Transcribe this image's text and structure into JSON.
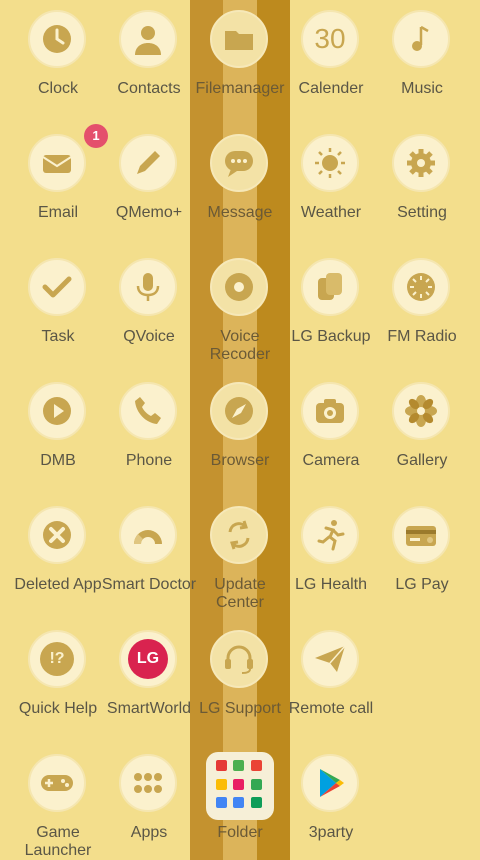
{
  "apps": [
    {
      "id": "clock",
      "label": "Clock",
      "icon": "clock-icon"
    },
    {
      "id": "contacts",
      "label": "Contacts",
      "icon": "person-icon"
    },
    {
      "id": "filemanager",
      "label": "Filemanager",
      "icon": "folder-icon"
    },
    {
      "id": "calender",
      "label": "Calender",
      "icon": "calendar-30-icon",
      "icon_text": "30"
    },
    {
      "id": "music",
      "label": "Music",
      "icon": "music-note-icon"
    },
    {
      "id": "email",
      "label": "Email",
      "icon": "envelope-icon",
      "badge": "1"
    },
    {
      "id": "qmemo",
      "label": "QMemo+",
      "icon": "pencil-icon"
    },
    {
      "id": "message",
      "label": "Message",
      "icon": "chat-bubble-icon"
    },
    {
      "id": "weather",
      "label": "Weather",
      "icon": "sun-icon"
    },
    {
      "id": "setting",
      "label": "Setting",
      "icon": "gear-icon"
    },
    {
      "id": "task",
      "label": "Task",
      "icon": "checkmark-icon"
    },
    {
      "id": "qvoice",
      "label": "QVoice",
      "icon": "microphone-icon"
    },
    {
      "id": "voice-recoder",
      "label": "Voice Recoder",
      "icon": "record-icon"
    },
    {
      "id": "lg-backup",
      "label": "LG Backup",
      "icon": "backup-cards-icon"
    },
    {
      "id": "fm-radio",
      "label": "FM Radio",
      "icon": "radio-dial-icon"
    },
    {
      "id": "dmb",
      "label": "DMB",
      "icon": "play-icon"
    },
    {
      "id": "phone",
      "label": "Phone",
      "icon": "phone-handset-icon"
    },
    {
      "id": "browser",
      "label": "Browser",
      "icon": "compass-icon"
    },
    {
      "id": "camera",
      "label": "Camera",
      "icon": "camera-icon"
    },
    {
      "id": "gallery",
      "label": "Gallery",
      "icon": "flower-icon"
    },
    {
      "id": "deleted-app",
      "label": "Deleted App",
      "icon": "x-circle-icon"
    },
    {
      "id": "smart-doctor",
      "label": "Smart Doctor",
      "icon": "gauge-icon"
    },
    {
      "id": "update-center",
      "label": "Update Center",
      "icon": "refresh-arrows-icon"
    },
    {
      "id": "lg-health",
      "label": "LG Health",
      "icon": "runner-icon"
    },
    {
      "id": "lg-pay",
      "label": "LG Pay",
      "icon": "credit-card-icon"
    },
    {
      "id": "quick-help",
      "label": "Quick Help",
      "icon": "help-bubble-icon",
      "icon_text": "!?"
    },
    {
      "id": "smartworld",
      "label": "SmartWorld",
      "icon": "lg-globe-icon",
      "icon_text": "LG"
    },
    {
      "id": "lg-support",
      "label": "LG Support",
      "icon": "headset-icon"
    },
    {
      "id": "remote-call",
      "label": "Remote call",
      "icon": "paper-plane-icon"
    },
    {
      "id": "game-launcher",
      "label": "Game Launcher",
      "icon": "gamepad-icon"
    },
    {
      "id": "apps",
      "label": "Apps",
      "icon": "app-grid-icon"
    },
    {
      "id": "folder",
      "label": "Folder",
      "icon": "app-folder-icon"
    },
    {
      "id": "3party",
      "label": "3party",
      "icon": "play-store-icon"
    }
  ],
  "colors": {
    "background": "#f3de8c",
    "stripe_dark": "#c4922f",
    "stripe_mid": "#dcb45a",
    "stripe_deep": "#bd8a1e",
    "icon_accent": "#c8a650",
    "badge": "#e4506c"
  }
}
